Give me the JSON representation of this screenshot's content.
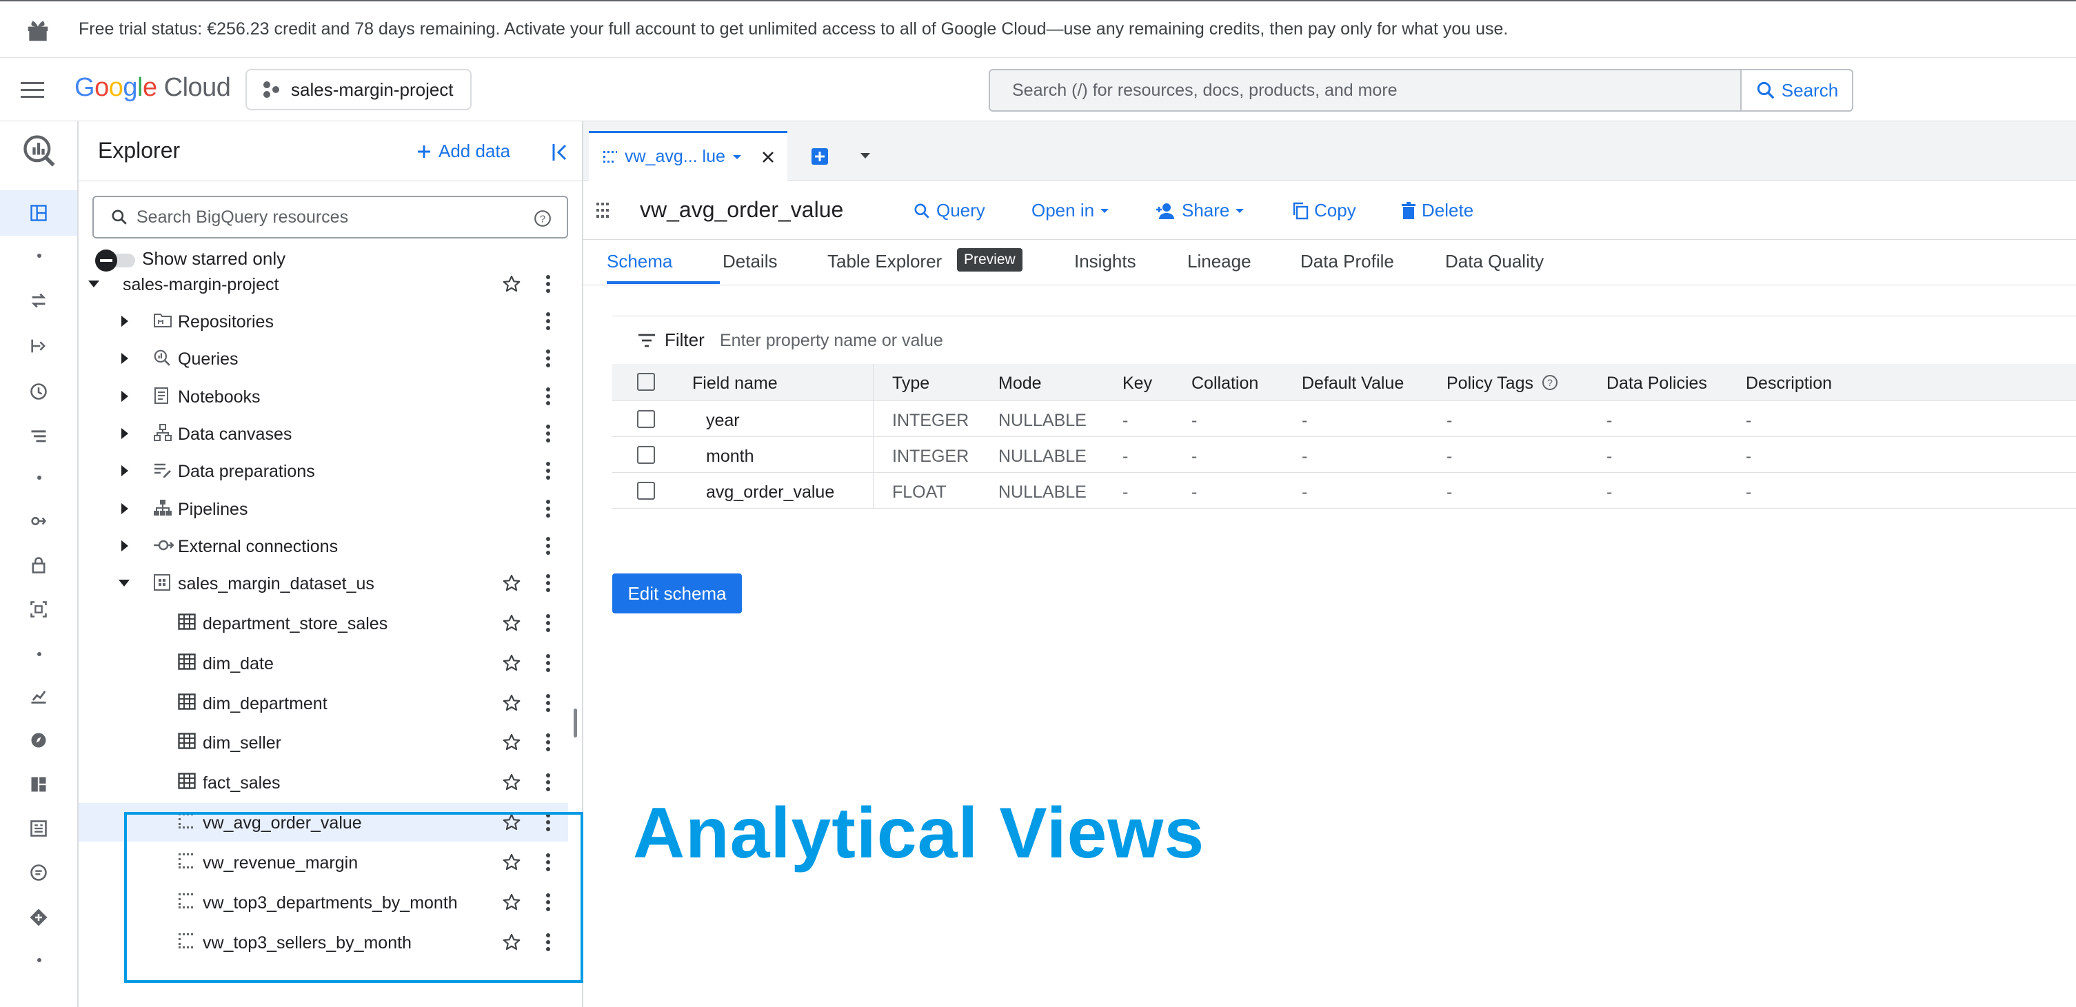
{
  "banner": {
    "text": "Free trial status: €256.23 credit and 78 days remaining. Activate your full account to get unlimited access to all of Google Cloud—use any remaining credits, then pay only for what you use."
  },
  "topbar": {
    "logo_google": "Google",
    "logo_cloud": "Cloud",
    "project": "sales-margin-project",
    "search_placeholder": "Search (/) for resources, docs, products, and more",
    "search_button": "Search"
  },
  "explorer": {
    "title": "Explorer",
    "add_data": "Add data",
    "search_placeholder": "Search BigQuery resources",
    "show_starred": "Show starred only",
    "tree": [
      {
        "label": "sales-margin-project",
        "icon": "project"
      },
      {
        "label": "Repositories",
        "icon": "repository-icon"
      },
      {
        "label": "Queries",
        "icon": "query-icon"
      },
      {
        "label": "Notebooks",
        "icon": "notebook-icon"
      },
      {
        "label": "Data canvases",
        "icon": "canvas-icon"
      },
      {
        "label": "Data preparations",
        "icon": "data-prep-icon"
      },
      {
        "label": "Pipelines",
        "icon": "pipeline-icon"
      },
      {
        "label": "External connections",
        "icon": "connection-icon"
      },
      {
        "label": "sales_margin_dataset_us",
        "icon": "dataset-icon"
      },
      {
        "label": "department_store_sales",
        "icon": "table-icon"
      },
      {
        "label": "dim_date",
        "icon": "table-icon"
      },
      {
        "label": "dim_department",
        "icon": "table-icon"
      },
      {
        "label": "dim_seller",
        "icon": "table-icon"
      },
      {
        "label": "fact_sales",
        "icon": "table-icon"
      },
      {
        "label": "vw_avg_order_value",
        "icon": "view-icon"
      },
      {
        "label": "vw_revenue_margin",
        "icon": "view-icon"
      },
      {
        "label": "vw_top3_departments_by_month",
        "icon": "view-icon"
      },
      {
        "label": "vw_top3_sellers_by_month",
        "icon": "view-icon"
      }
    ]
  },
  "editor_tab": {
    "label": "vw_avg... lue"
  },
  "resource": {
    "name": "vw_avg_order_value",
    "actions": {
      "query": "Query",
      "open_in": "Open in",
      "share": "Share",
      "copy": "Copy",
      "delete": "Delete"
    }
  },
  "subtabs": {
    "schema": "Schema",
    "details": "Details",
    "table_explorer": "Table Explorer",
    "preview_chip": "Preview",
    "insights": "Insights",
    "lineage": "Lineage",
    "data_profile": "Data Profile",
    "data_quality": "Data Quality"
  },
  "filter": {
    "label": "Filter",
    "placeholder": "Enter property name or value"
  },
  "schema": {
    "columns": [
      "Field name",
      "Type",
      "Mode",
      "Key",
      "Collation",
      "Default Value",
      "Policy Tags",
      "Data Policies",
      "Description"
    ],
    "rows": [
      [
        "year",
        "INTEGER",
        "NULLABLE",
        "-",
        "-",
        "-",
        "-",
        "-",
        "-"
      ],
      [
        "month",
        "INTEGER",
        "NULLABLE",
        "-",
        "-",
        "-",
        "-",
        "-",
        "-"
      ],
      [
        "avg_order_value",
        "FLOAT",
        "NULLABLE",
        "-",
        "-",
        "-",
        "-",
        "-",
        "-"
      ]
    ],
    "edit_button": "Edit schema"
  },
  "overlay": {
    "caption": "Analytical Views"
  },
  "colors": {
    "accent": "#1a73e8",
    "annotation": "#039be5"
  }
}
